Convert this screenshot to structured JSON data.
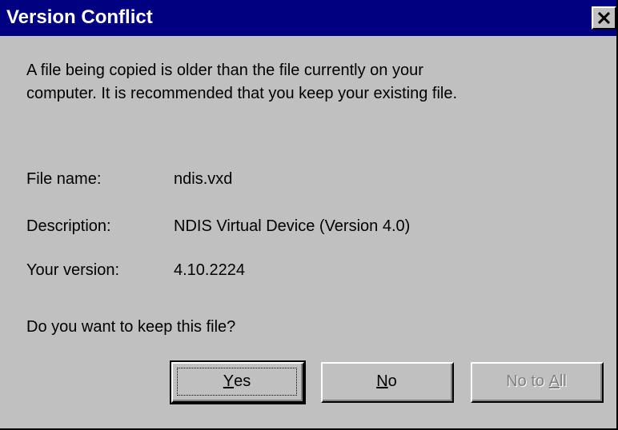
{
  "window": {
    "title": "Version Conflict",
    "close_glyph": "✕",
    "close_icon": "close-icon"
  },
  "message": {
    "line1": "A file being copied is older than the file currently on your",
    "line2": "computer. It is recommended that you keep your existing file."
  },
  "fields": {
    "file_name_label": "File name:",
    "file_name_value": "ndis.vxd",
    "description_label": "Description:",
    "description_value": "NDIS Virtual Device  (Version 4.0)",
    "your_version_label": "Your version:",
    "your_version_value": "4.10.2224"
  },
  "question": "Do you want to keep this file?",
  "buttons": {
    "yes": {
      "mnemonic": "Y",
      "rest": "es",
      "is_default": true,
      "enabled": true
    },
    "no": {
      "mnemonic": "N",
      "rest": "o",
      "enabled": true
    },
    "no_to_all": {
      "prefix": "No to ",
      "mnemonic": "A",
      "rest": "ll",
      "enabled": false
    }
  },
  "colors": {
    "titlebar": "#000080",
    "title_text": "#ffffff",
    "face": "#c0c0c0",
    "disabled_text": "#808080"
  }
}
